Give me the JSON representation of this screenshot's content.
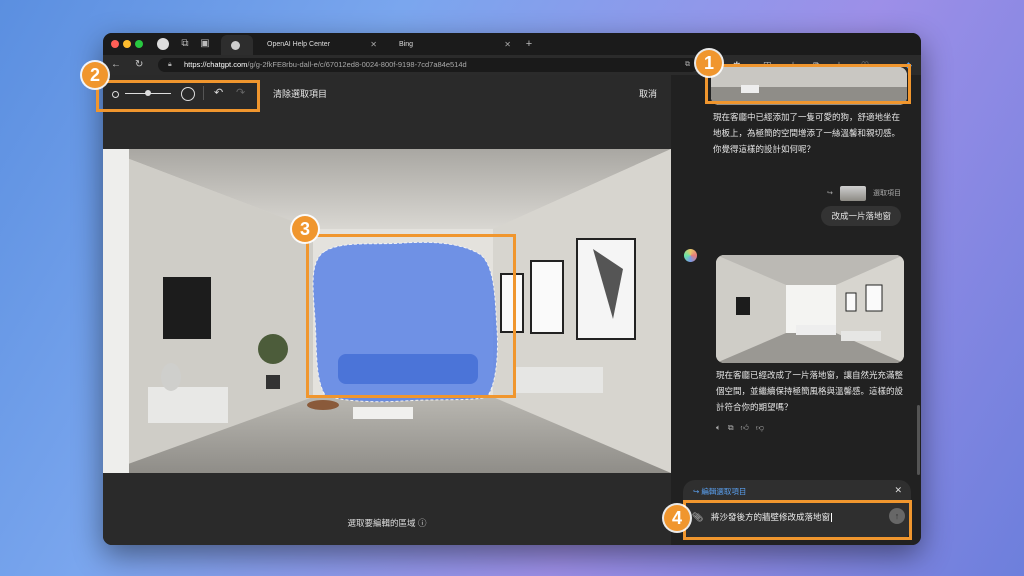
{
  "browser": {
    "tabs": [
      {
        "label": "OpenAI Help Center"
      },
      {
        "label": "Bing"
      }
    ],
    "new_tab": "+",
    "url_host": "https://chatgpt.com",
    "url_path": "/g/g-2fkFE8rbu-dall-e/c/67012ed8-0024-800f-9198-7cd7a84e514d"
  },
  "editor": {
    "clear_selection": "清除選取項目",
    "cancel": "取消",
    "hint": "選取要編輯的區域",
    "info_icon": "ⓘ"
  },
  "chat": {
    "msg1": "現在客廳中已經添加了一隻可愛的狗，舒適地坐在地板上，為極簡的空間增添了一絲溫馨和親切感。你覺得這樣的設計如何呢？",
    "selected_ref": "選取項目",
    "user_msg": "改成一片落地窗",
    "msg2": "現在客廳已經改成了一片落地窗，讓自然光充滿整個空間，並繼續保持極簡風格與溫馨感。這樣的設計符合你的期望嗎？",
    "composer_label": "編輯選取項目",
    "composer_text": "將沙發後方的牆壁修改成落地窗"
  },
  "annotations": [
    "1",
    "2",
    "3",
    "4"
  ],
  "colors": {
    "accent": "#f0962e",
    "selection": "#5a82e6",
    "link_blue": "#5aa0f0"
  }
}
